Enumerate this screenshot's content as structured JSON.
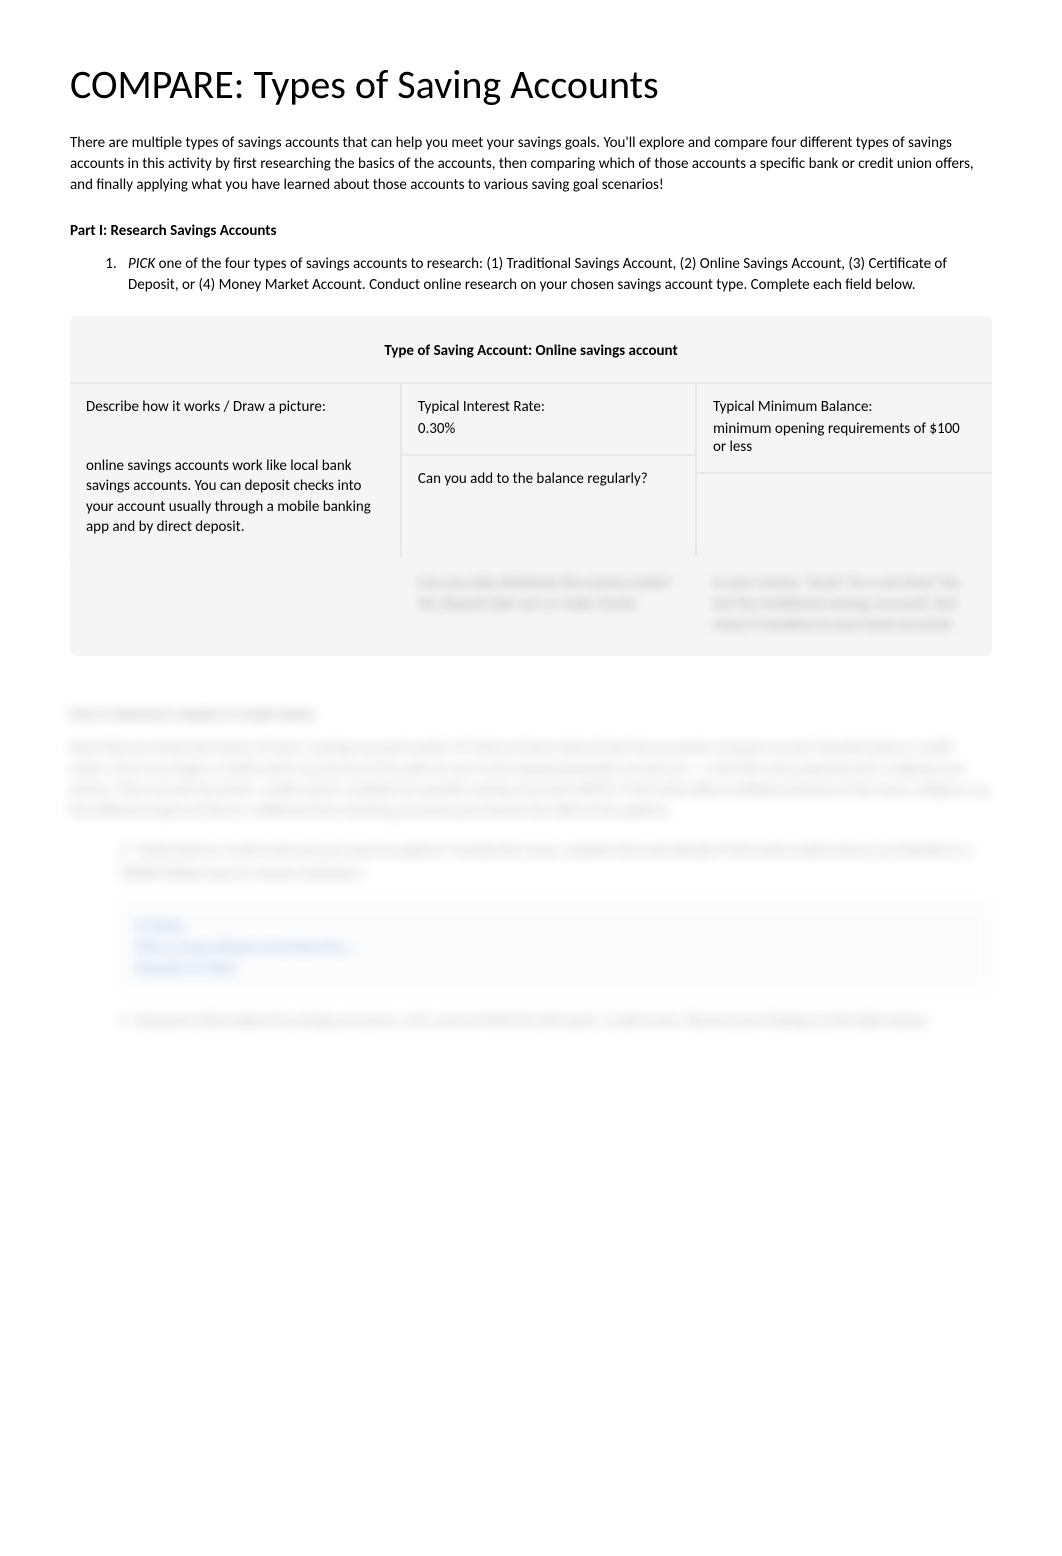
{
  "title": "COMPARE: Types of Saving Accounts",
  "intro": "There are multiple types of savings accounts that can help you meet your savings goals. You'll explore and compare four different types of savings accounts in this activity by first researching the basics of the accounts, then comparing which of those accounts a specific bank or credit union offers, and finally applying what you have learned about those accounts to various saving goal scenarios!",
  "part1_heading": "Part I: Research Savings Accounts",
  "instruction1_pick": "PICK",
  "instruction1_text": " one of the four types of savings accounts to research: (1) Traditional Savings Account, (2) Online Savings Account, (3) Certificate of Deposit, or (4) Money Market Account. Conduct online research on your chosen savings account type. Complete each field below.",
  "table": {
    "header": "Type of Saving Account: Online savings account",
    "describe_label": "Describe how it works / Draw a picture:",
    "describe_value": "online savings accounts work like local bank savings accounts. You can deposit checks into your account usually through a mobile banking app and by direct deposit.",
    "interest_label": "Typical Interest Rate:",
    "interest_value": "0.30%",
    "balance_label": "Typical Minimum Balance:",
    "balance_value": "minimum opening requirements of $100 or less",
    "add_label": "Can you add to the balance regularly?"
  },
  "blurred": {
    "row2_mid": "Can you take distribute the money easily?\nYes deposit take out or make checks",
    "row2_right": "Is your money \"stuck\" for a set time?\nYes but the traditional savings accounts. But many it handled on your bank accounts",
    "part2_heading": "Part II: Research a Bank or Credit Union",
    "part2_text": "Now that you know the basics of how a savings account works. It's time to learn look at how the accounts compare at your favorite bank or credit union. Once you begin a credit union account you'll be able to use it and expand gradually consult you – a site like www.experienced is helping your choice. They consult the bank / credit union's website for specific savings accounts (NOTE: if the bank offers multiple products of the same category e.g. five different types of CDs or 3 different free checking accounts just choose the ONE of the options.",
    "item2": "What bank or credit union do you want to explore? Include the name, website link and indicate if this bank credit union is an ONLINE or a TRADITIONAL brick & mortar institution.",
    "link1": "CIT Bank",
    "link2": "https://www.citbank.com/index.htm...",
    "link3": "Deposits CIT Bank",
    "item3": "Research information for savings accounts, a CD, and an MMA for this bank / credit union. Record your findings in the table below."
  }
}
